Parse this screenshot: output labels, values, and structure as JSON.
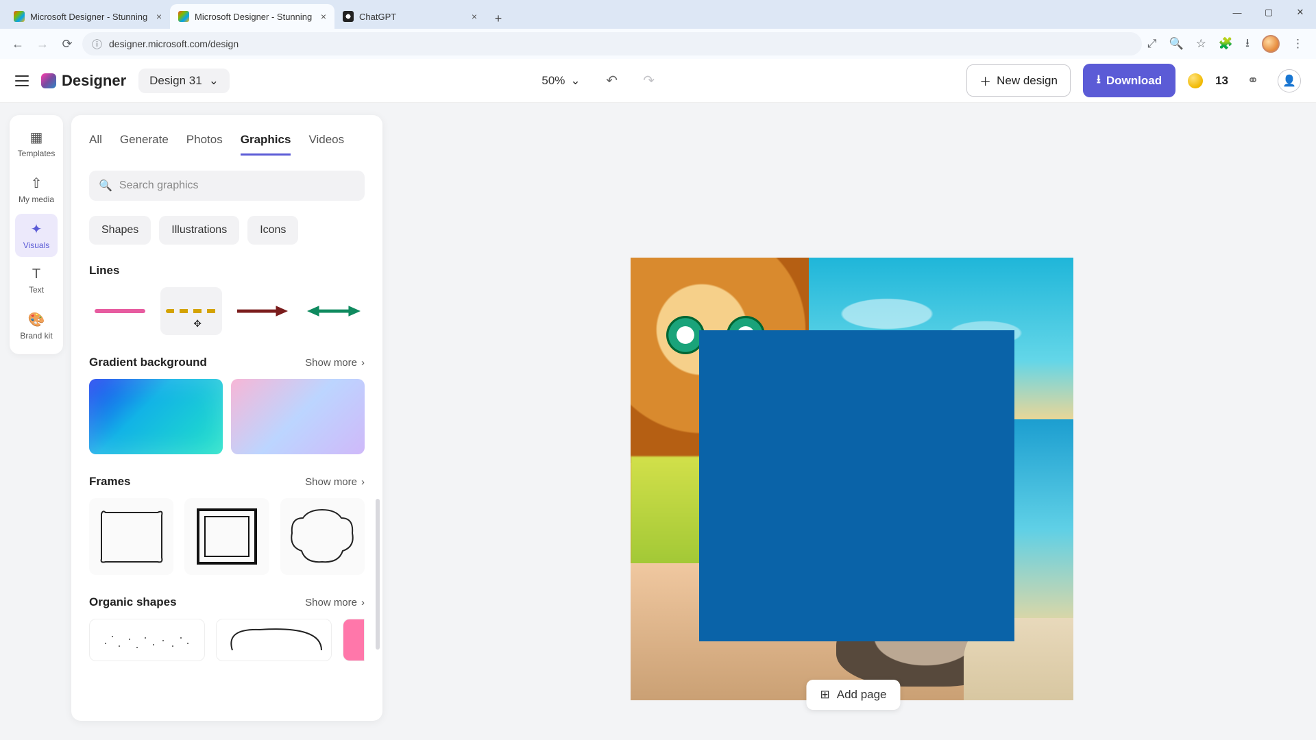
{
  "browser": {
    "tabs": [
      {
        "title": "Microsoft Designer - Stunning",
        "active": false
      },
      {
        "title": "Microsoft Designer - Stunning",
        "active": true
      },
      {
        "title": "ChatGPT",
        "active": false
      }
    ],
    "url": "designer.microsoft.com/design"
  },
  "header": {
    "brand": "Designer",
    "design_name": "Design 31",
    "zoom": "50%",
    "new_design": "New design",
    "download": "Download",
    "coin_count": "13"
  },
  "rail": {
    "templates": "Templates",
    "my_media": "My media",
    "visuals": "Visuals",
    "text": "Text",
    "brand_kit": "Brand kit"
  },
  "panel": {
    "tabs": {
      "all": "All",
      "generate": "Generate",
      "photos": "Photos",
      "graphics": "Graphics",
      "videos": "Videos"
    },
    "search_placeholder": "Search graphics",
    "chips": {
      "shapes": "Shapes",
      "illustrations": "Illustrations",
      "icons": "Icons"
    },
    "sections": {
      "lines": "Lines",
      "gradient": "Gradient background",
      "frames": "Frames",
      "organic": "Organic shapes"
    },
    "show_more": "Show more"
  },
  "canvas": {
    "add_page": "Add page"
  }
}
